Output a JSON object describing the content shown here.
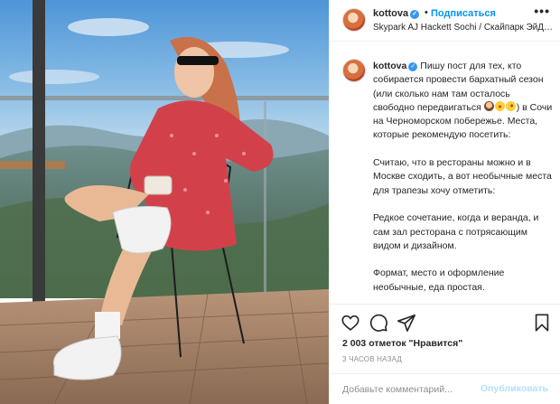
{
  "post": {
    "photo_alt": "",
    "author": "kottova",
    "follow_label": "Подписаться",
    "separator": "•",
    "location": "Skypark AJ Hackett Sochi / Скайпарк ЭйДже...",
    "more_label": "•••"
  },
  "caption": {
    "author": "kottova",
    "paragraph1_a": "Пишу пост для тех, кто собирается провести бархатный сезон (или сколько нам там осталось свободно передвигаться",
    "paragraph1_b": ") в Сочи на Черноморском побережье. Места, которые рекомендую посетить:",
    "paragraph2": "Считаю, что в рестораны можно и в Москве сходить, а вот необычные места для трапезы хочу отметить:",
    "paragraph3": "Редкое сочетание, когда и веранда, и сам зал ресторана с потрясающим видом и дизайном.",
    "paragraph4": "Формат, место и оформление необычные, еда простая."
  },
  "actions": {
    "likes_text": "2 003 отметок \"Нравится\"",
    "time_text": "3 ЧАСОВ НАЗАД"
  },
  "comment": {
    "placeholder": "Добавьте комментарий...",
    "publish_label": "Опубликовать"
  },
  "icons": {
    "verified": "verified-badge-icon",
    "like": "heart-icon",
    "comment": "comment-bubble-icon",
    "share": "paper-plane-icon",
    "save": "bookmark-icon"
  },
  "colors": {
    "link_blue": "#0095f6",
    "verified_blue": "#3897f0",
    "publish_disabled": "#b2dffc",
    "muted_text": "#8e8e8e",
    "border": "#efefef"
  }
}
